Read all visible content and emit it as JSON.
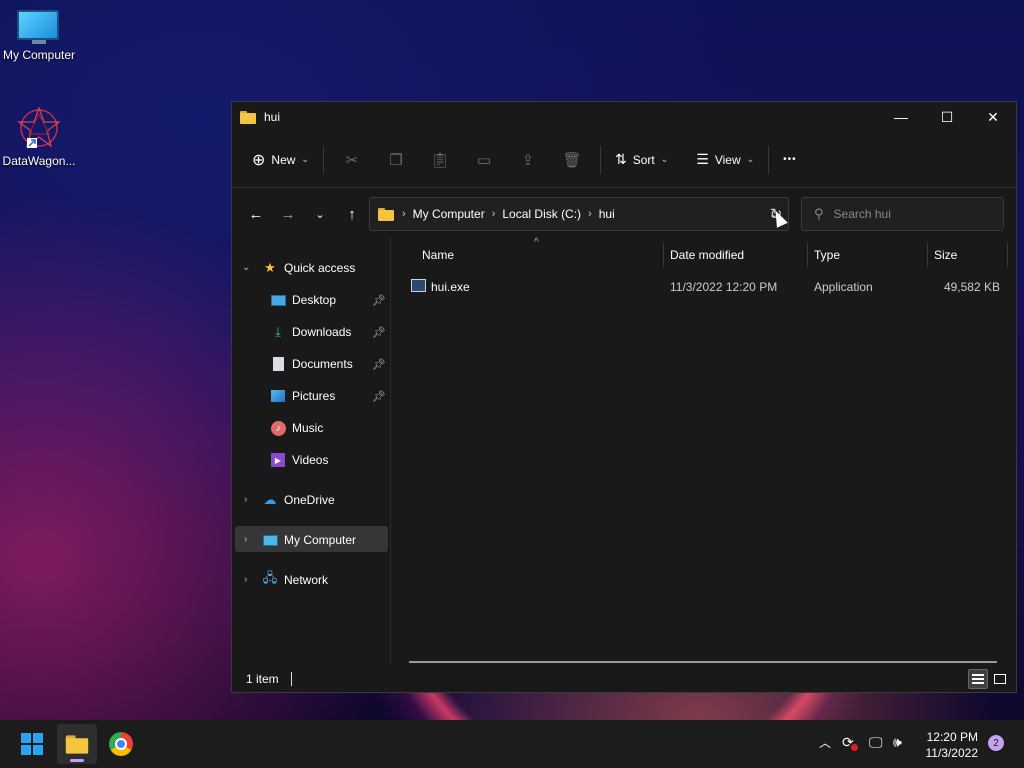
{
  "desktop": {
    "icons": [
      {
        "label": "My Computer",
        "icon": "monitor-icon"
      },
      {
        "label": "DataWagon...",
        "icon": "datawagon-icon"
      }
    ]
  },
  "window": {
    "title": "hui",
    "controls": {
      "minimize": "—",
      "maximize": "☐",
      "close": "✕"
    }
  },
  "toolbar": {
    "new_label": "New",
    "sort_label": "Sort",
    "view_label": "View",
    "more_label": "•••"
  },
  "address": {
    "crumbs": [
      "My Computer",
      "Local Disk (C:)",
      "hui"
    ]
  },
  "search": {
    "placeholder": "Search hui"
  },
  "sidebar": {
    "quick_access": "Quick access",
    "items": [
      {
        "label": "Desktop",
        "pinned": true,
        "icon": "desktop-icon"
      },
      {
        "label": "Downloads",
        "pinned": true,
        "icon": "downloads-icon"
      },
      {
        "label": "Documents",
        "pinned": true,
        "icon": "documents-icon"
      },
      {
        "label": "Pictures",
        "pinned": true,
        "icon": "pictures-icon"
      },
      {
        "label": "Music",
        "pinned": false,
        "icon": "music-icon"
      },
      {
        "label": "Videos",
        "pinned": false,
        "icon": "videos-icon"
      }
    ],
    "onedrive": "OneDrive",
    "my_computer": "My Computer",
    "network": "Network"
  },
  "columns": {
    "name": "Name",
    "date": "Date modified",
    "type": "Type",
    "size": "Size"
  },
  "files": [
    {
      "name": "hui.exe",
      "date": "11/3/2022 12:20 PM",
      "type": "Application",
      "size": "49,582 KB"
    }
  ],
  "status": {
    "count": "1 item"
  },
  "taskbar": {
    "time": "12:20 PM",
    "date": "11/3/2022",
    "notifications": "2"
  }
}
